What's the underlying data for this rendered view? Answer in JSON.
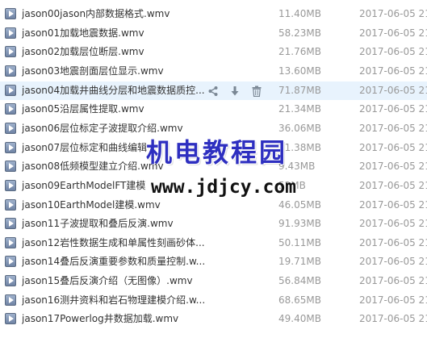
{
  "files": [
    {
      "name": "jason00jason内部数据格式.wmv",
      "size": "11.40MB",
      "date": "2017-06-05 21"
    },
    {
      "name": "jason01加载地震数据.wmv",
      "size": "58.23MB",
      "date": "2017-06-05 21"
    },
    {
      "name": "jason02加载层位断层.wmv",
      "size": "21.76MB",
      "date": "2017-06-05 21"
    },
    {
      "name": "jason03地震剖面层位显示.wmv",
      "size": "13.60MB",
      "date": "2017-06-05 21"
    },
    {
      "name": "jason04加载井曲线分层和地震数据质控...",
      "size": "71.87MB",
      "date": "2017-06-05 21",
      "hovered": true
    },
    {
      "name": "jason05沿层属性提取.wmv",
      "size": "21.34MB",
      "date": "2017-06-05 21"
    },
    {
      "name": "jason06层位标定子波提取介绍.wmv",
      "size": "36.06MB",
      "date": "2017-06-05 21"
    },
    {
      "name": "jason07层位标定和曲线编辑",
      "size": "21.38MB",
      "date": "2017-06-05 21"
    },
    {
      "name": "jason08低频模型建立介绍.wmv",
      "size": "9.43MB",
      "date": "2017-06-05 21"
    },
    {
      "name": "jason09EarthModelFT建模",
      "size": "52MB",
      "date": "2017-06-05 21"
    },
    {
      "name": "jason10EarthModel建模.wmv",
      "size": "46.05MB",
      "date": "2017-06-05 21"
    },
    {
      "name": "jason11子波提取和叠后反演.wmv",
      "size": "91.93MB",
      "date": "2017-06-05 21"
    },
    {
      "name": "jason12岩性数据生成和单属性刻画砂体...",
      "size": "50.11MB",
      "date": "2017-06-05 21"
    },
    {
      "name": "jason14叠后反演重要参数和质量控制.w...",
      "size": "19.71MB",
      "date": "2017-06-05 21"
    },
    {
      "name": "jason15叠后反演介绍（无图像）.wmv",
      "size": "56.84MB",
      "date": "2017-06-05 21"
    },
    {
      "name": "jason16测井资料和岩石物理建模介绍.w...",
      "size": "68.65MB",
      "date": "2017-06-05 21"
    },
    {
      "name": "jason17Powerlog井数据加载.wmv",
      "size": "49.40MB",
      "date": "2017-06-05 21"
    }
  ],
  "row_actions": {
    "share_icon": "share-icon",
    "download_icon": "download-icon",
    "delete_icon": "trash-icon"
  },
  "watermark": {
    "chinese": "机电教程园",
    "url": "www.jdjcy.com"
  },
  "colors": {
    "hover_row": "#e8f3fd",
    "watermark_blue": "#2e2fc0",
    "meta_text": "#999999"
  }
}
